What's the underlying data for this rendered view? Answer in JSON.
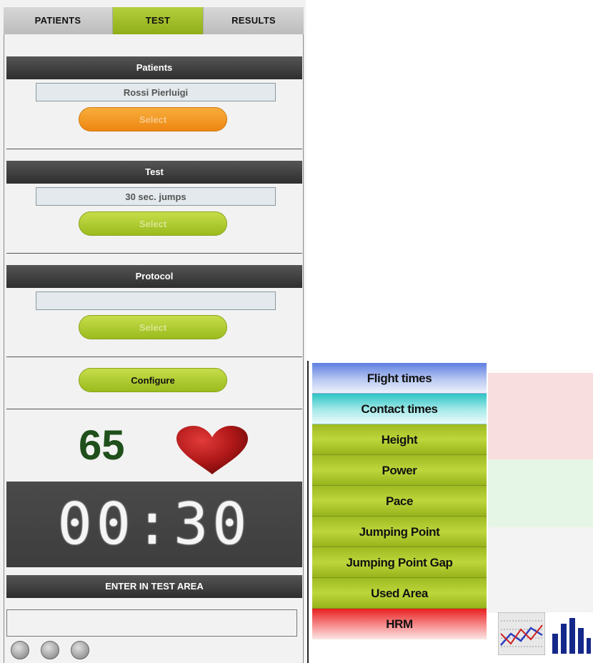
{
  "tabs": [
    {
      "label": "PATIENTS",
      "active": false
    },
    {
      "label": "TEST",
      "active": true
    },
    {
      "label": "RESULTS",
      "active": false
    }
  ],
  "patients": {
    "header": "Patients",
    "value": "Rossi Pierluigi",
    "button": "Select"
  },
  "test": {
    "header": "Test",
    "value": "30 sec. jumps",
    "button": "Select"
  },
  "protocol": {
    "header": "Protocol",
    "value": "",
    "button": "Select"
  },
  "configure_button": "Configure",
  "heart_rate": "65",
  "timer": "00:30",
  "enter_test_area": {
    "header": "ENTER IN TEST AREA",
    "value": ""
  },
  "indicators": [
    "off",
    "off",
    "off"
  ],
  "metrics_menu": [
    {
      "label": "Flight times",
      "style": "blue"
    },
    {
      "label": "Contact times",
      "style": "cyan"
    },
    {
      "label": "Height",
      "style": "green"
    },
    {
      "label": "Power",
      "style": "green"
    },
    {
      "label": "Pace",
      "style": "green"
    },
    {
      "label": "Jumping Point",
      "style": "green"
    },
    {
      "label": "Jumping Point Gap",
      "style": "green"
    },
    {
      "label": "Used Area",
      "style": "green"
    },
    {
      "label": "HRM",
      "style": "red"
    }
  ],
  "colors": {
    "accent_green": "#a6c42a",
    "select_orange": "#f39c26",
    "heart_red": "#b01818",
    "hr_text": "#1f4f1a",
    "band_red": "#f8dede",
    "band_green": "#e6f6e6",
    "band_grey": "#f3f3f3"
  },
  "icons": [
    "line-chart-icon",
    "bar-chart-icon"
  ]
}
